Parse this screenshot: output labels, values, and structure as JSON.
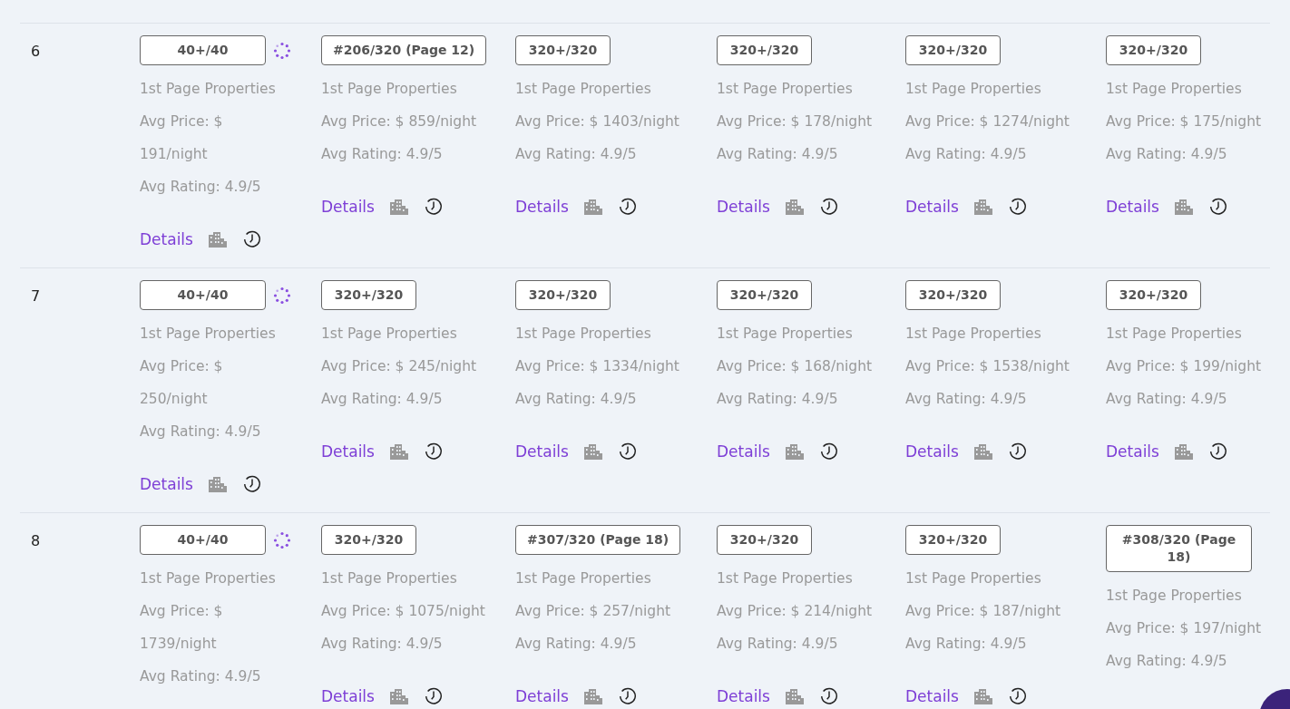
{
  "rows": [
    {
      "rank": "6",
      "cells": [
        {
          "badge": "40+/40",
          "loading": true,
          "label": "1st Page Properties",
          "price": "Avg Price: $ 191/night",
          "rating": "Avg Rating: 4.9/5",
          "details": "Details"
        },
        {
          "badge": "#206/320 (Page 12)",
          "loading": false,
          "label": "1st Page Properties",
          "price": "Avg Price: $ 859/night",
          "rating": "Avg Rating: 4.9/5",
          "details": "Details"
        },
        {
          "badge": "320+/320",
          "loading": false,
          "label": "1st Page Properties",
          "price": "Avg Price: $ 1403/night",
          "rating": "Avg Rating: 4.9/5",
          "details": "Details"
        },
        {
          "badge": "320+/320",
          "loading": false,
          "label": "1st Page Properties",
          "price": "Avg Price: $ 178/night",
          "rating": "Avg Rating: 4.9/5",
          "details": "Details"
        },
        {
          "badge": "320+/320",
          "loading": false,
          "label": "1st Page Properties",
          "price": "Avg Price: $ 1274/night",
          "rating": "Avg Rating: 4.9/5",
          "details": "Details"
        },
        {
          "badge": "320+/320",
          "loading": false,
          "label": "1st Page Properties",
          "price": "Avg Price: $ 175/night",
          "rating": "Avg Rating: 4.9/5",
          "details": "Details"
        }
      ]
    },
    {
      "rank": "7",
      "cells": [
        {
          "badge": "40+/40",
          "loading": true,
          "label": "1st Page Properties",
          "price": "Avg Price: $ 250/night",
          "rating": "Avg Rating: 4.9/5",
          "details": "Details"
        },
        {
          "badge": "320+/320",
          "loading": false,
          "label": "1st Page Properties",
          "price": "Avg Price: $ 245/night",
          "rating": "Avg Rating: 4.9/5",
          "details": "Details"
        },
        {
          "badge": "320+/320",
          "loading": false,
          "label": "1st Page Properties",
          "price": "Avg Price: $ 1334/night",
          "rating": "Avg Rating: 4.9/5",
          "details": "Details"
        },
        {
          "badge": "320+/320",
          "loading": false,
          "label": "1st Page Properties",
          "price": "Avg Price: $ 168/night",
          "rating": "Avg Rating: 4.9/5",
          "details": "Details"
        },
        {
          "badge": "320+/320",
          "loading": false,
          "label": "1st Page Properties",
          "price": "Avg Price: $ 1538/night",
          "rating": "Avg Rating: 4.9/5",
          "details": "Details"
        },
        {
          "badge": "320+/320",
          "loading": false,
          "label": "1st Page Properties",
          "price": "Avg Price: $ 199/night",
          "rating": "Avg Rating: 4.9/5",
          "details": "Details"
        }
      ]
    },
    {
      "rank": "8",
      "cells": [
        {
          "badge": "40+/40",
          "loading": true,
          "label": "1st Page Properties",
          "price": "Avg Price: $ 1739/night",
          "rating": "Avg Rating: 4.9/5"
        },
        {
          "badge": "320+/320",
          "loading": false,
          "label": "1st Page Properties",
          "price": "Avg Price: $ 1075/night",
          "rating": "Avg Rating: 4.9/5",
          "details": "Details"
        },
        {
          "badge": "#307/320 (Page 18)",
          "loading": false,
          "label": "1st Page Properties",
          "price": "Avg Price: $ 257/night",
          "rating": "Avg Rating: 4.9/5",
          "details": "Details"
        },
        {
          "badge": "320+/320",
          "loading": false,
          "label": "1st Page Properties",
          "price": "Avg Price: $ 214/night",
          "rating": "Avg Rating: 4.9/5",
          "details": "Details"
        },
        {
          "badge": "320+/320",
          "loading": false,
          "label": "1st Page Properties",
          "price": "Avg Price: $ 187/night",
          "rating": "Avg Rating: 4.9/5",
          "details": "Details"
        },
        {
          "badge": "#308/320 (Page 18)",
          "loading": false,
          "label": "1st Page Properties",
          "price": "Avg Price: $ 197/night",
          "rating": "Avg Rating: 4.9/5"
        }
      ]
    }
  ]
}
